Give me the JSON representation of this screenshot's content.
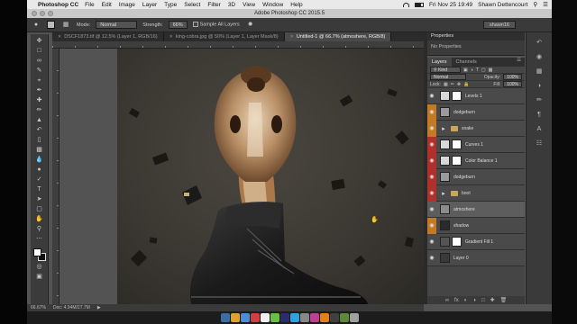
{
  "menubar": {
    "apple_glyph": "",
    "app_name": "Photoshop CC",
    "menus": [
      "File",
      "Edit",
      "Image",
      "Layer",
      "Type",
      "Select",
      "Filter",
      "3D",
      "View",
      "Window",
      "Help"
    ],
    "datetime": "Fri Nov 25 19:49",
    "user": "Shawn Dettencourt"
  },
  "titlebar": {
    "title": "Adobe Photoshop CC 2015.5"
  },
  "optionsbar": {
    "mode_label": "Mode:",
    "mode_value": "Normal",
    "strength_label": "Strength:",
    "strength_value": "66%",
    "sample_all_label": "Sample All Layers",
    "workspace": "shawn16"
  },
  "tabs": [
    {
      "label": "DSCF1873.tif @ 12.5% (Layer 1, RGB/16)",
      "active": false
    },
    {
      "label": "king-cobra.jpg @ 50% (Layer 1, Layer Mask/8)",
      "active": false
    },
    {
      "label": "Untitled-1 @ 66.7% (atmoshere, RGB/8)",
      "active": true
    }
  ],
  "statusbar": {
    "zoom": "66.67%",
    "doc": "Doc: 4.94M/27.7M"
  },
  "properties": {
    "tab": "Properties",
    "body": "No Properties"
  },
  "layers_panel": {
    "tabs": [
      "Layers",
      "Channels"
    ],
    "kind_filter": "Kind",
    "blend_mode": "Normal",
    "opacity_label": "Opacity:",
    "opacity_value": "100%",
    "lock_label": "Lock:",
    "fill_label": "Fill:",
    "fill_value": "100%",
    "layers": [
      {
        "name": "Levels 1",
        "eye": "normal",
        "kind": "adjustment",
        "thumb": "#d8d8d8",
        "selected": false
      },
      {
        "name": "dodgeburn",
        "eye": "orange",
        "kind": "pixel",
        "thumb": "#9a9a9a",
        "selected": false
      },
      {
        "name": "snake",
        "eye": "orange",
        "kind": "group",
        "thumb": "",
        "selected": false
      },
      {
        "name": "Curves 1",
        "eye": "red",
        "kind": "adjustment",
        "thumb": "#d8d8d8",
        "selected": false
      },
      {
        "name": "Color Balance 1",
        "eye": "red",
        "kind": "adjustment",
        "thumb": "#d8d8d8",
        "selected": false
      },
      {
        "name": "dodgeburn",
        "eye": "red",
        "kind": "pixel",
        "thumb": "#9a9a9a",
        "selected": false
      },
      {
        "name": "boot",
        "eye": "red",
        "kind": "group",
        "thumb": "",
        "selected": false
      },
      {
        "name": "atmoshere",
        "eye": "normal",
        "kind": "pixel",
        "thumb": "#8c8c8c",
        "selected": true
      },
      {
        "name": "shadow",
        "eye": "orange",
        "kind": "pixel",
        "thumb": "#2a2a2a",
        "selected": false
      },
      {
        "name": "Gradient Fill 1",
        "eye": "normal",
        "kind": "fill",
        "thumb": "#555555",
        "selected": false
      },
      {
        "name": "Layer 0",
        "eye": "normal",
        "kind": "pixel",
        "thumb": "#3a3a3a",
        "selected": false
      }
    ]
  },
  "colors": {
    "orange_tag": "#c47a24",
    "red_tag": "#b0302b",
    "panel_bg": "#454545",
    "app_bg": "#535353"
  }
}
